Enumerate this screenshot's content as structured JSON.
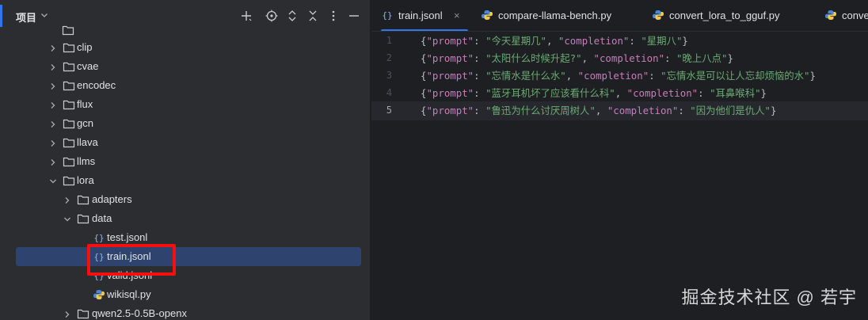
{
  "project": {
    "title": "项目",
    "tree": [
      {
        "label": "clip",
        "kind": "folder",
        "depth": 1,
        "expanded": false
      },
      {
        "label": "cvae",
        "kind": "folder",
        "depth": 1,
        "expanded": false
      },
      {
        "label": "encodec",
        "kind": "folder",
        "depth": 1,
        "expanded": false
      },
      {
        "label": "flux",
        "kind": "folder",
        "depth": 1,
        "expanded": false
      },
      {
        "label": "gcn",
        "kind": "folder",
        "depth": 1,
        "expanded": false
      },
      {
        "label": "llava",
        "kind": "folder",
        "depth": 1,
        "expanded": false
      },
      {
        "label": "llms",
        "kind": "folder",
        "depth": 1,
        "expanded": false
      },
      {
        "label": "lora",
        "kind": "folder",
        "depth": 1,
        "expanded": true
      },
      {
        "label": "adapters",
        "kind": "folder",
        "depth": 2,
        "expanded": false
      },
      {
        "label": "data",
        "kind": "folder",
        "depth": 2,
        "expanded": true
      },
      {
        "label": "test.jsonl",
        "kind": "json",
        "depth": 3
      },
      {
        "label": "train.jsonl",
        "kind": "json",
        "depth": 3,
        "selected": true
      },
      {
        "label": "valid.jsonl",
        "kind": "json",
        "depth": 3
      },
      {
        "label": "wikisql.py",
        "kind": "python",
        "depth": 3
      },
      {
        "label": "qwen2.5-0.5B-openx",
        "kind": "folder",
        "depth": 2,
        "expanded": false
      }
    ]
  },
  "tabs": [
    {
      "label": "train.jsonl",
      "kind": "json",
      "active": true
    },
    {
      "label": "compare-llama-bench.py",
      "kind": "python"
    },
    {
      "label": "convert_lora_to_gguf.py",
      "kind": "python"
    },
    {
      "label": "conve",
      "kind": "python"
    }
  ],
  "editor": {
    "current_line": 5,
    "lines": [
      {
        "num": "1",
        "prompt": "今天星期几",
        "completion": "星期八"
      },
      {
        "num": "2",
        "prompt": "太阳什么时候升起?",
        "completion": "晚上八点"
      },
      {
        "num": "3",
        "prompt": "忘情水是什么水",
        "completion": "忘情水是可以让人忘却烦恼的水"
      },
      {
        "num": "4",
        "prompt": "蓝牙耳机坏了应该看什么科",
        "completion": "耳鼻喉科"
      },
      {
        "num": "5",
        "prompt": "鲁迅为什么讨厌周树人",
        "completion": "因为他们是仇人"
      }
    ],
    "key_prompt": "\"prompt\"",
    "key_completion": "\"completion\""
  },
  "watermark": "掘金技术社区 @ 若宇",
  "colors": {
    "selection": "#2e436e",
    "accent": "#3574f0",
    "highlight_box": "#f50f0f"
  }
}
